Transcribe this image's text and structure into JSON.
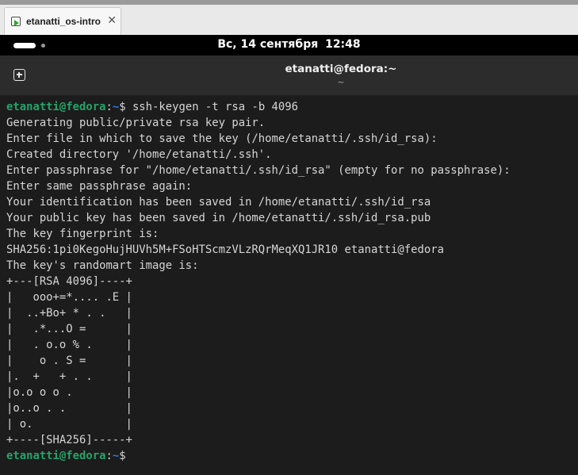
{
  "host": {
    "tab_title": "etanatti_os-intro",
    "tab_close": "✕"
  },
  "topbar": {
    "date": "Вс, 14 сентября",
    "time": "12:48"
  },
  "terminal_window": {
    "title": "etanatti@fedora:~",
    "subtitle": "~"
  },
  "terminal": {
    "prompt_user": "etanatti@fedora",
    "prompt_sep": ":",
    "prompt_path": "~",
    "prompt_symbol": "$",
    "command": " ssh-keygen -t rsa -b 4096",
    "output": [
      "Generating public/private rsa key pair.",
      "Enter file in which to save the key (/home/etanatti/.ssh/id_rsa):",
      "Created directory '/home/etanatti/.ssh'.",
      "Enter passphrase for \"/home/etanatti/.ssh/id_rsa\" (empty for no passphrase):",
      "Enter same passphrase again:",
      "Your identification has been saved in /home/etanatti/.ssh/id_rsa",
      "Your public key has been saved in /home/etanatti/.ssh/id_rsa.pub",
      "The key fingerprint is:",
      "SHA256:1pi0KegoHujHUVh5M+FSoHTScmzVLzRQrMeqXQ1JR10 etanatti@fedora",
      "The key's randomart image is:",
      "+---[RSA 4096]----+",
      "|   ooo+=*.... .E |",
      "|  ..+Bo+ * . .   |",
      "|   .*...O =      |",
      "|   . o.o % .     |",
      "|    o . S =      |",
      "|.  +   + . .     |",
      "|o.o o o .        |",
      "|o..o . .         |",
      "| o.              |",
      "+----[SHA256]-----+"
    ]
  }
}
